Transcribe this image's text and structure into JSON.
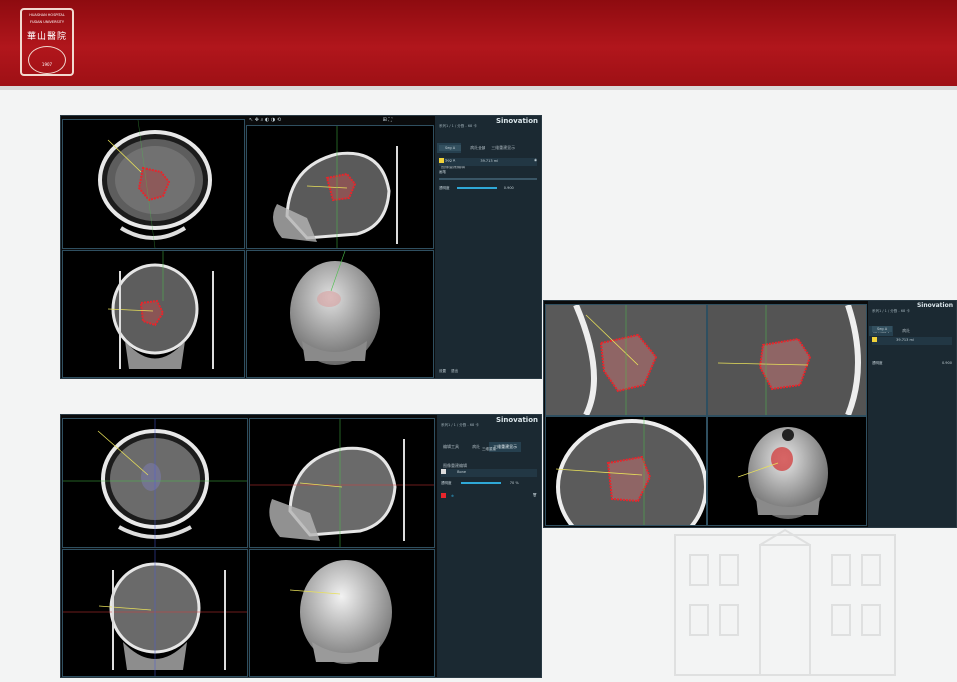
{
  "banner": {
    "logo_line1": "HUASHAN HOSPITAL",
    "logo_line2": "FUDAN UNIVERSITY",
    "logo_chinese": "華山醫院",
    "logo_year": "1907",
    "colors": {
      "banner": "#a3141a",
      "background": "#f3f4f4"
    }
  },
  "app": {
    "brand": "Sinovation",
    "series_info": "系列1 / 1 / 分割 - 68 卡",
    "tabs": [
      "编辑工具",
      "病灶",
      "三维重建显示",
      "图像重建编辑"
    ],
    "segment_name": "Seg A",
    "segment_value": "39.713 ml",
    "seg_header_left": "Seg A",
    "seg_header_right": "全部",
    "opacity_label": "透明度",
    "opacity_value": "0.900",
    "brush_label": "画笔",
    "threshold_label": "阈值",
    "footer_labels": [
      "设置",
      "退出"
    ],
    "volume_label": "Bone",
    "volume_opacity_label": "透明度",
    "volume_opacity_value": "70 %",
    "reconstruct_label": "三维重建",
    "colors": {
      "panel": "#1b2932",
      "accent": "#2fa8d6",
      "lesion": "#e8252b",
      "crosshair_yellow": "#e8e05a",
      "crosshair_green": "#4bc04b",
      "crosshair_red": "#d63a3a"
    }
  },
  "icons": [
    "cursor-icon",
    "pan-icon",
    "zoom-icon",
    "window-level-icon",
    "measure-icon",
    "reset-icon",
    "layout-icon",
    "fullscreen-icon",
    "eye-icon",
    "settings-icon",
    "trash-icon",
    "add-icon"
  ]
}
